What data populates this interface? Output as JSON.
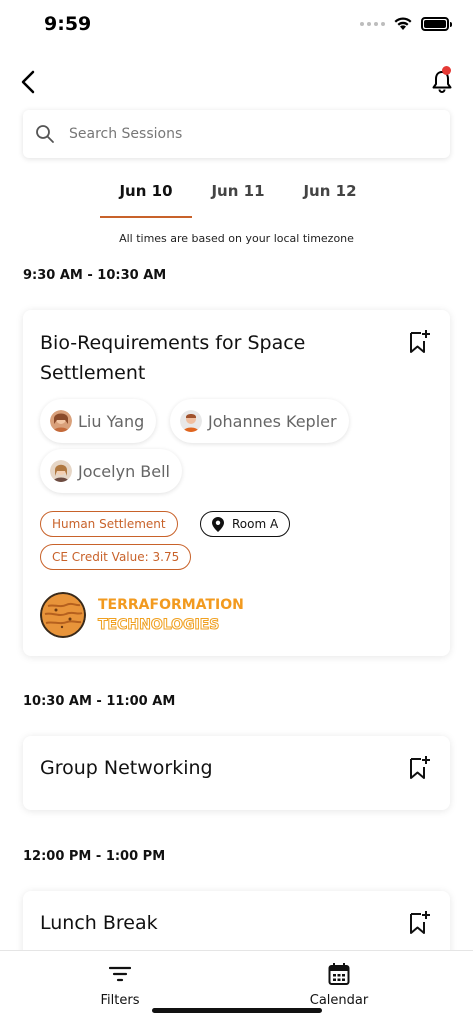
{
  "status_bar": {
    "time": "9:59"
  },
  "search": {
    "placeholder": "Search Sessions"
  },
  "date_tabs": [
    {
      "label": "Jun 10",
      "active": true
    },
    {
      "label": "Jun 11",
      "active": false
    },
    {
      "label": "Jun 12",
      "active": false
    }
  ],
  "timezone_note": "All times are based on your local timezone",
  "sessions": [
    {
      "time": "9:30 AM - 10:30 AM",
      "title": "Bio-Requirements for Space Settlement",
      "speakers": [
        "Liu Yang",
        "Johannes Kepler",
        "Jocelyn Bell"
      ],
      "tags": {
        "track": "Human Settlement",
        "location": "Room A",
        "credit": "CE Credit Value: 3.75"
      },
      "sponsor": {
        "line1": "TERRAFORMATION",
        "line2": "TECHNOLOGIES"
      }
    },
    {
      "time": "10:30 AM - 11:00 AM",
      "title": "Group Networking"
    },
    {
      "time": "12:00 PM - 1:00 PM",
      "title": "Lunch Break"
    }
  ],
  "bottom_nav": {
    "filters": "Filters",
    "calendar": "Calendar"
  },
  "colors": {
    "accent": "#c8622a",
    "notification": "#e53935",
    "sponsor": "#f29a1f"
  }
}
